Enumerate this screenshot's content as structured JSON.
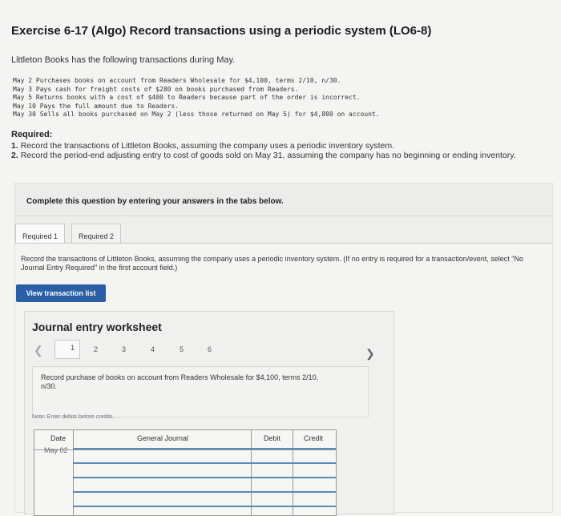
{
  "title": "Exercise 6-17 (Algo) Record transactions using a periodic system (LO6-8)",
  "intro": "Littleton Books has the following transactions during May.",
  "transactions": [
    "May 2 Purchases books on account from Readers Wholesale for $4,100, terms 2/10, n/30.",
    "May 3 Pays cash for freight costs of $280 on books purchased from Readers.",
    "May 5 Returns books with a cost of $400 to Readers because part of the order is incorrect.",
    "May 10 Pays the full amount due to Readers.",
    "May 30 Sells all books purchased on May 2 (less those returned on May 5) for $4,800 on account."
  ],
  "required": {
    "heading": "Required:",
    "item1_num": "1.",
    "item1": "Record the transactions of Littleton Books, assuming the company uses a periodic inventory system.",
    "item2_num": "2.",
    "item2": "Record the period-end adjusting entry to cost of goods sold on May 31, assuming the company has no beginning or ending inventory."
  },
  "panel": {
    "heading": "Complete this question by entering your answers in the tabs below.",
    "tabs": [
      "Required 1",
      "Required 2"
    ],
    "instructions": "Record the transactions of Littleton Books, assuming the company uses a periodic inventory system. (If no entry is required for a transaction/event, select \"No Journal Entry Required\" in the first account field.)",
    "view_button": "View transaction list"
  },
  "worksheet": {
    "title": "Journal entry worksheet",
    "prev_icon": "chevron-left-icon",
    "next_icon": "chevron-right-icon",
    "pages": [
      "1",
      "2",
      "3",
      "4",
      "5",
      "6"
    ],
    "current_page": "1",
    "description": "Record purchase of books on account from Readers Wholesale for $4,100, terms 2/10, n/30.",
    "note": "Note: Enter debits before credits.",
    "columns": [
      "Date",
      "General Journal",
      "Debit",
      "Credit"
    ],
    "date_value": "May 02"
  }
}
